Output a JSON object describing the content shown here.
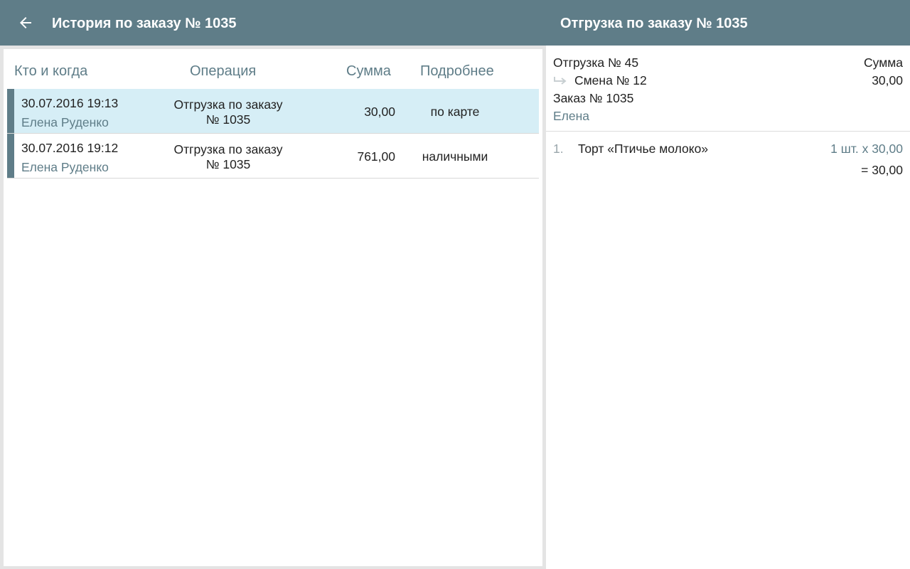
{
  "header": {
    "left_title": "История по заказу № 1035",
    "right_title": "Отгрузка по заказу № 1035"
  },
  "history": {
    "columns": [
      "Кто и когда",
      "Операция",
      "Сумма",
      "Подробнее"
    ],
    "rows": [
      {
        "when": "30.07.2016 19:13",
        "who": "Елена Руденко",
        "operation": "Отгрузка по заказу",
        "order": "№ 1035",
        "sum": "30,00",
        "detail": "по карте",
        "selected": true
      },
      {
        "when": "30.07.2016 19:12",
        "who": "Елена Руденко",
        "operation": "Отгрузка по заказу",
        "order": "№ 1035",
        "sum": "761,00",
        "detail": "наличными",
        "selected": false
      }
    ]
  },
  "shipment": {
    "title": "Отгрузка № 45",
    "shift": "Смена № 12",
    "order": "Заказ № 1035",
    "employee": "Елена",
    "sum_label": "Сумма",
    "sum_value": "30,00",
    "items": [
      {
        "index": "1.",
        "name": "Торт «Птичье молоко»",
        "qty_price": "1 шт. x 30,00",
        "total": "= 30,00"
      }
    ]
  },
  "colors": {
    "primary": "#5f7d88",
    "selected_row": "#d6eef6",
    "background": "#e4e4e4"
  },
  "icons": {
    "back": "arrow-left-icon",
    "shift": "return-arrow-icon"
  }
}
